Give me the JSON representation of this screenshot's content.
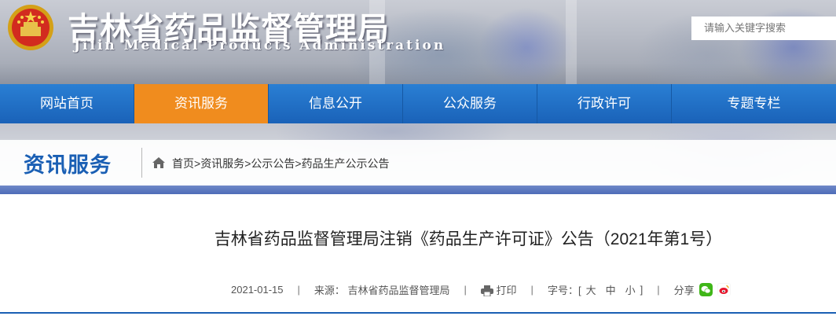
{
  "header": {
    "title": "吉林省药品监督管理局",
    "subtitle": "Jilin Medical Products Administration",
    "search_placeholder": "请输入关键字搜索"
  },
  "nav": {
    "items": [
      {
        "label": "网站首页"
      },
      {
        "label": "资讯服务",
        "active": true
      },
      {
        "label": "信息公开"
      },
      {
        "label": "公众服务"
      },
      {
        "label": "行政许可"
      },
      {
        "label": "专题专栏"
      }
    ]
  },
  "section": {
    "title": "资讯服务",
    "breadcrumb": [
      "首页",
      "资讯服务",
      "公示公告",
      "药品生产公示公告"
    ],
    "separator": ">"
  },
  "article": {
    "title": "吉林省药品监督管理局注销《药品生产许可证》公告（2021年第1号）",
    "date": "2021-01-15",
    "source": "来源： 吉林省药品监督管理局",
    "print": "打印",
    "font_size_label": "字号：[",
    "font_sizes": [
      "大",
      "中",
      "小"
    ],
    "font_size_close": "]",
    "share": "分享",
    "divider": "|"
  },
  "colors": {
    "nav_blue": "#1e6ec7",
    "nav_active": "#f08c1e",
    "title_blue": "#1a5fb4",
    "wechat_green": "#3fb618",
    "weibo_red": "#e6162d"
  }
}
